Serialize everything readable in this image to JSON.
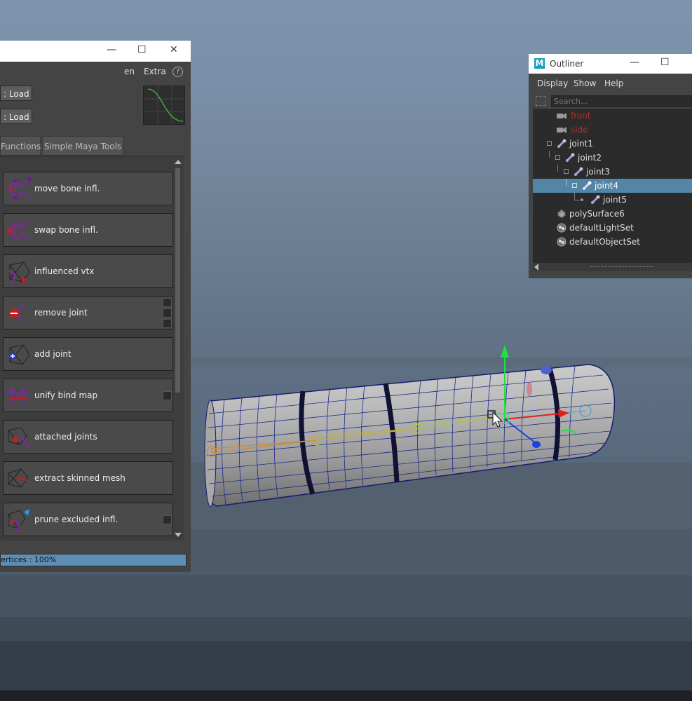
{
  "skin_panel": {
    "title_buttons": {
      "minimize": "—",
      "maximize": "☐",
      "close": "✕"
    },
    "menu": [
      "en",
      "Extra"
    ],
    "help_label": "?",
    "load_buttons": [
      ": Load",
      ": Load"
    ],
    "tabs": [
      "Functions",
      "Simple Maya Tools"
    ],
    "tools": [
      {
        "label": "move bone infl.",
        "icon": "move-bone-icon"
      },
      {
        "label": "swap bone infl.",
        "icon": "swap-bone-icon"
      },
      {
        "label": "influenced vtx",
        "icon": "influenced-vertex-icon"
      },
      {
        "label": "remove joint",
        "icon": "remove-joint-icon"
      },
      {
        "label": "add joint",
        "icon": "add-joint-icon"
      },
      {
        "label": "unify bind map",
        "icon": "unify-bind-map-icon"
      },
      {
        "label": "attached joints",
        "icon": "attached-joints-icon"
      },
      {
        "label": "extract skinned mesh",
        "icon": "extract-mesh-icon"
      },
      {
        "label": "prune excluded infl.",
        "icon": "prune-icon"
      }
    ],
    "progress": {
      "label": "ertices : 100%",
      "value": 100
    }
  },
  "outliner": {
    "title": "Outliner",
    "logo": "M",
    "title_buttons": {
      "minimize": "—",
      "maximize": "☐"
    },
    "menu": [
      "Display",
      "Show",
      "Help"
    ],
    "search_placeholder": "Search...",
    "items": [
      {
        "label": "front",
        "icon": "camera-icon",
        "color": "#b03030"
      },
      {
        "label": "side",
        "icon": "camera-icon",
        "color": "#b03030"
      },
      {
        "label": "joint1",
        "icon": "joint-icon",
        "color": "#dddddd"
      },
      {
        "label": "joint2",
        "icon": "joint-icon",
        "color": "#dddddd"
      },
      {
        "label": "joint3",
        "icon": "joint-icon",
        "color": "#dddddd"
      },
      {
        "label": "joint4",
        "icon": "joint-icon",
        "color": "#ffffff"
      },
      {
        "label": "joint5",
        "icon": "joint-icon",
        "color": "#dddddd"
      },
      {
        "label": "polySurface6",
        "icon": "mesh-icon",
        "color": "#dddddd"
      },
      {
        "label": "defaultLightSet",
        "icon": "set-icon",
        "color": "#dddddd"
      },
      {
        "label": "defaultObjectSet",
        "icon": "set-icon",
        "color": "#dddddd"
      }
    ],
    "selected_item": "joint4"
  },
  "colors": {
    "accent_selection": "#5285a6",
    "progress": "#5d8fb5",
    "panel_bg": "#444444"
  }
}
